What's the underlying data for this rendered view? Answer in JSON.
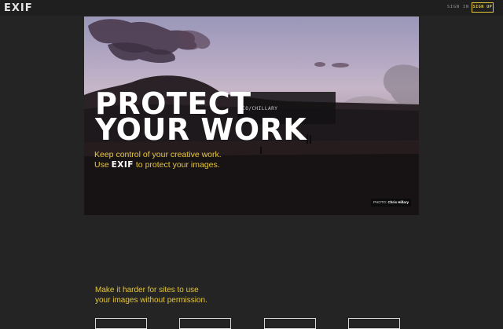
{
  "header": {
    "logo": "EXIF",
    "sign_in": "SIGN IN",
    "sign_up": "SIGN UP"
  },
  "hero": {
    "title_line1": "PROTECT",
    "title_line2": "YOUR WORK",
    "url_overlay": ".CO/CHILLARY",
    "tagline_line1": "Keep control of your creative work.",
    "tagline_use": "Use",
    "tagline_brand": "EXIF",
    "tagline_rest": "to protect your images.",
    "credit_prefix": "PHOTO:",
    "credit_name": "Chris Hillary"
  },
  "section": {
    "heading_line1": "Make it harder for sites to use",
    "heading_line2": "your images without permission."
  },
  "colors": {
    "accent": "#e5c73a",
    "background": "#242424",
    "topbar": "#1f1f1f"
  }
}
